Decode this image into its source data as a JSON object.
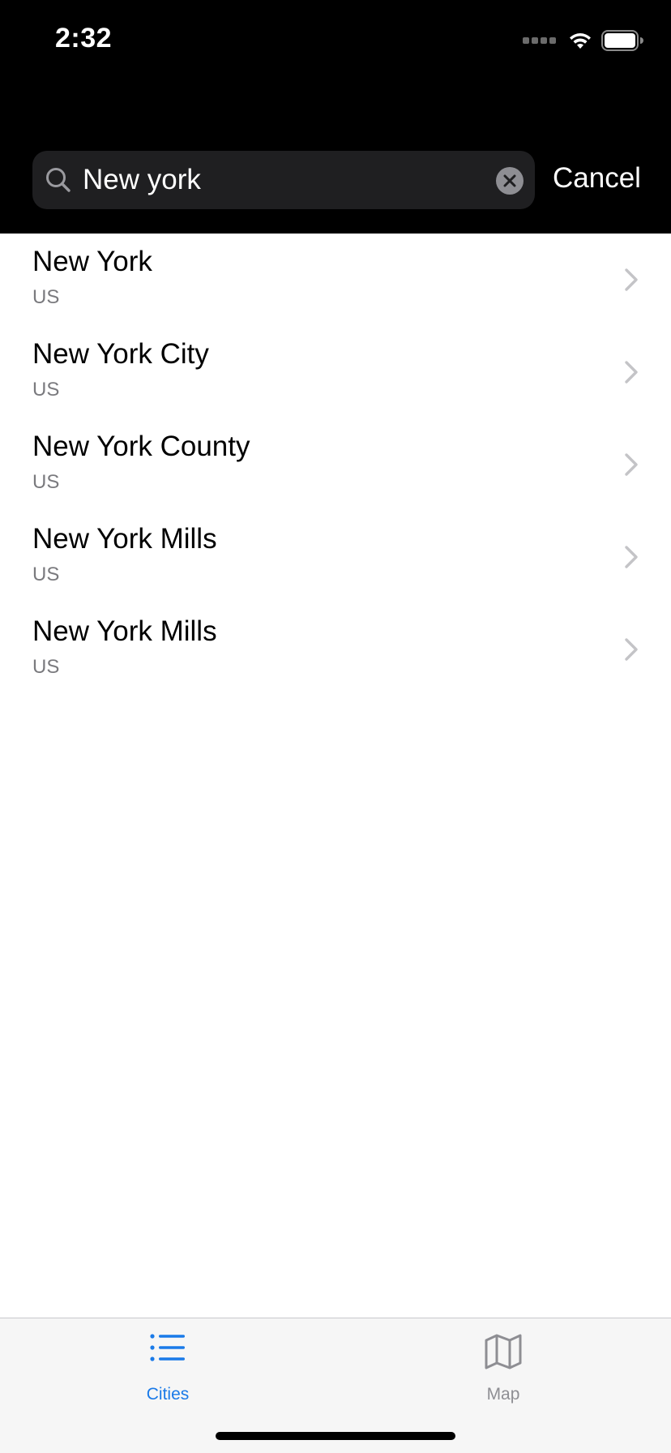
{
  "status_bar": {
    "time": "2:32",
    "signal_icon": "cellular-signal-icon",
    "wifi_icon": "wifi-icon",
    "battery_icon": "battery-icon"
  },
  "search": {
    "value": "New york",
    "search_icon": "search-icon",
    "clear_icon": "clear-icon",
    "cancel_label": "Cancel"
  },
  "results": [
    {
      "title": "New York",
      "subtitle": "US"
    },
    {
      "title": "New York City",
      "subtitle": "US"
    },
    {
      "title": "New York County",
      "subtitle": "US"
    },
    {
      "title": "New York Mills",
      "subtitle": "US"
    },
    {
      "title": "New York Mills",
      "subtitle": "US"
    }
  ],
  "tab_bar": {
    "tabs": [
      {
        "label": "Cities",
        "icon": "list-icon",
        "selected": true
      },
      {
        "label": "Map",
        "icon": "map-icon",
        "selected": false
      }
    ]
  },
  "colors": {
    "accent": "#1a7ae8",
    "header_bg": "#000000",
    "search_field_bg": "#1f1f21",
    "tab_inactive": "#8e8e93"
  }
}
